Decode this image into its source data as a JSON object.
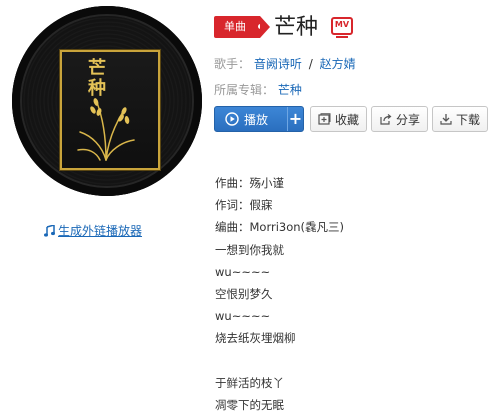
{
  "colors": {
    "accent": "#d8262c",
    "link": "#1a68b7",
    "play_button": "#2f75c6",
    "gold": "#c9a43b"
  },
  "cover": {
    "title": "芒种"
  },
  "left_link": {
    "label": "生成外链播放器",
    "icon": "music-note-icon"
  },
  "header": {
    "badge": "单曲",
    "title": "芒种",
    "mv_label": "MV"
  },
  "singer": {
    "label": "歌手：",
    "artists": [
      "音阙诗听",
      "赵方婧"
    ],
    "separator": "/"
  },
  "album": {
    "label": "所属专辑：",
    "name": "芒种"
  },
  "actions": {
    "play": "播放",
    "add": "+",
    "collect": "收藏",
    "share": "分享",
    "download": "下载"
  },
  "lyrics": [
    "作曲：殇小谨",
    "作词：假寐",
    "编曲：Morri3on(毳凡三)",
    "一想到你我就",
    "wu~~~~",
    "空恨别梦久",
    "wu~~~~",
    "烧去纸灰埋烟柳",
    "",
    "于鲜活的枝丫",
    "凋零下的无眠"
  ]
}
